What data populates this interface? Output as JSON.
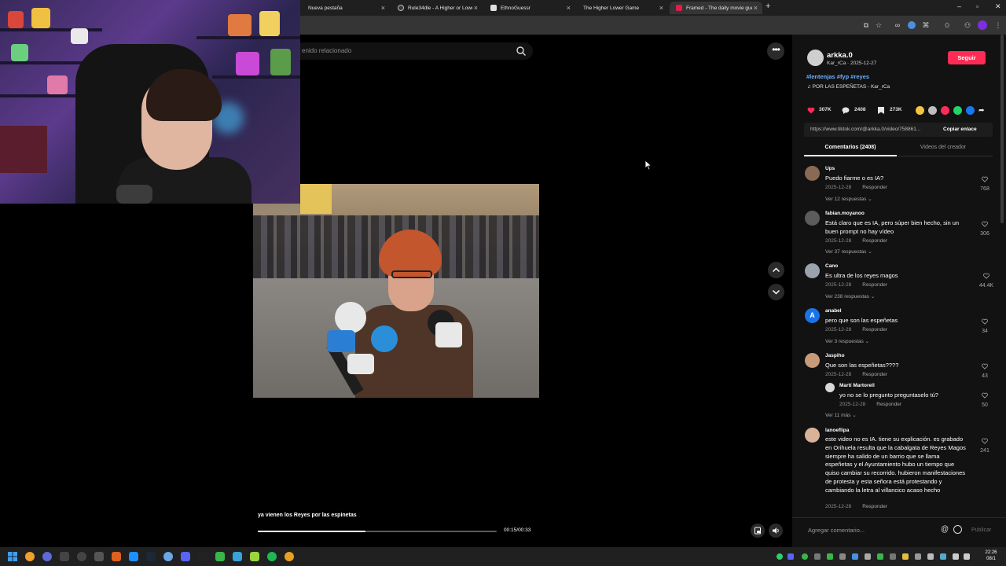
{
  "browser": {
    "tabs": [
      {
        "title": "Nueva pestaña",
        "color": "#5a5a5a"
      },
      {
        "title": "Rule34dle - A Higher or Lower",
        "color": "#3a3a3a"
      },
      {
        "title": "EthnoGuessr",
        "color": "#e0e0e0"
      },
      {
        "title": "The Higher Lower Game",
        "color": "#3a3a3a"
      },
      {
        "title": "Framed - The daily movie guess",
        "color": "#e11d48"
      }
    ],
    "active_tab": 4,
    "new_tab": "+"
  },
  "search": {
    "placeholder": "enido relacionado"
  },
  "more_button": "•••",
  "video": {
    "caption": "ya vienen los Reyes por las espinetas",
    "time": "00:15/00:33",
    "progress_fraction": 0.45
  },
  "post": {
    "username": "arkka.0",
    "sub": "Kar_rCa · 2025-12-27",
    "follow": "Seguir",
    "hashtags": "#lentenjas #fyp #reyes",
    "music": "♫  POR LAS ESPEÑETAS - Kar_rCa",
    "likes": "307K",
    "comments": "2408",
    "saves": "273K",
    "link": "https://www.tiktok.com/@arkka.0/video/758861...",
    "copy_link": "Copiar enlace"
  },
  "panel_tabs": {
    "comments": "Comentarios (2408)",
    "creator_videos": "Videos del creador"
  },
  "comments": [
    {
      "user": "Ups",
      "text": "Puedo fiarme o es IA?",
      "date": "2025-12-28",
      "reply": "Responder",
      "likes": "768",
      "more": "Ver 12 respuestas ⌄",
      "avatar": "#8a6a55"
    },
    {
      "user": "fabian.moyanoo",
      "text": "Está claro que es IA, pero súper bien hecho, sin un buen prompt no hay vídeo",
      "date": "2025-12-28",
      "reply": "Responder",
      "likes": "306",
      "more": "Ver 37 respuestas ⌄",
      "avatar": "#5c5c5c"
    },
    {
      "user": "Cano",
      "text": "Es ultra de los reyes magos",
      "date": "2025-12-28",
      "reply": "Responder",
      "likes": "44.4K",
      "more": "Ver 238 respuestas ⌄",
      "avatar": "#9aa3ad"
    },
    {
      "user": "anabel",
      "text": "pero que son las espeñetas",
      "date": "2025-12-28",
      "reply": "Responder",
      "likes": "34",
      "more": "Ver 3 respuestas ⌄",
      "avatar": "#1a73e8",
      "initial": "A"
    },
    {
      "user": "Jaspiho",
      "text": "Que son las espeñetas????",
      "date": "2025-12-28",
      "reply": "Responder",
      "likes": "43",
      "more": "Ver 11 más ⌄",
      "avatar": "#c79a7a"
    },
    {
      "user": "lanoeflipa",
      "text": "este video no es IA. tiene su explicación. es grabado en Orihuela resulta que la cabalgata de Reyes Magos siempre ha salido de un barrio que se llama espeñetas y el Ayuntamiento hubo un tiempo que quiso cambiar su recorrido. hubieron manifestaciones de protesta y esta señora está protestando y cambiando la letra al villancico acaso hecho",
      "date": "2025-12-28",
      "reply": "Responder",
      "likes": "241",
      "avatar": "#d8b39a"
    }
  ],
  "reply": {
    "user": "Martí Martorell",
    "text": "yo no se lo pregunto preguntaselo tú?",
    "date": "2025-12-28",
    "reply": "Responder",
    "likes": "50"
  },
  "comment_bar": {
    "placeholder": "Agregar comentario...",
    "at": "@",
    "post": "Publicar"
  },
  "clock": {
    "time": "22:26",
    "date": "08/1"
  },
  "colors": {
    "accent": "#fe2c55",
    "hashtag": "#6db0ff",
    "panel": "#121212"
  }
}
